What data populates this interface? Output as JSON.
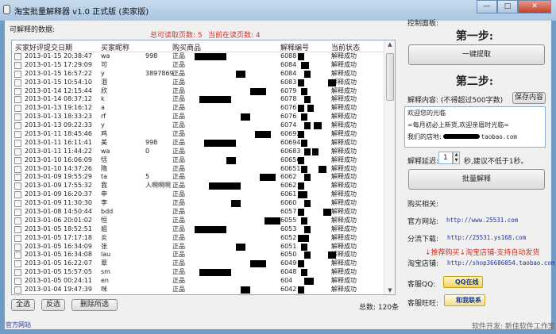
{
  "window": {
    "title": "淘宝批量解释器 v1.0 正式版 (卖家版)",
    "min": "—",
    "max": "□",
    "close": "✕"
  },
  "left": {
    "section_label": "可解释的数据:",
    "pages_total": "总可读取页数: 5",
    "pages_current": "当前在读页数: 4",
    "columns": [
      "买家好评提交日期",
      "买家昵称",
      "购买商品",
      "解释编号",
      "当前状态"
    ],
    "rows": [
      {
        "date": "2013-01-15 20:38:47",
        "nick": "wa",
        "nick2": "998",
        "item": "正品",
        "code": "6088",
        "status": "解释成功"
      },
      {
        "date": "2013-01-15 17:29:09",
        "nick": "可",
        "nick2": "",
        "item": "正品",
        "code": "6084",
        "status": "解释成功"
      },
      {
        "date": "2013-01-15 16:57:22",
        "nick": "y",
        "nick2": "3897869",
        "item": "正品",
        "code": "6084",
        "status": "解释成功"
      },
      {
        "date": "2013-01-15 10:54:10",
        "nick": "泪",
        "nick2": "",
        "item": "正品",
        "code": "6083",
        "status": "解释成功"
      },
      {
        "date": "2013-01-14 12:15:44",
        "nick": "欣",
        "nick2": "",
        "item": "正品",
        "code": "6079",
        "status": "解释成功"
      },
      {
        "date": "2013-01-14 08:37:12",
        "nick": "k",
        "nick2": "",
        "item": "正品",
        "code": "6078",
        "status": "解释成功"
      },
      {
        "date": "2013-01-13 19:16:12",
        "nick": "a",
        "nick2": "",
        "item": "正品",
        "code": "6076",
        "status": "解释成功"
      },
      {
        "date": "2013-01-13 18:33:23",
        "nick": "rf",
        "nick2": "",
        "item": "正品",
        "code": "6076",
        "status": "解释成功"
      },
      {
        "date": "2013-01-13 09:22:33",
        "nick": "y",
        "nick2": "",
        "item": "正品",
        "code": "6074",
        "status": "解释成功"
      },
      {
        "date": "2013-01-11 18:45:46",
        "nick": "鸡",
        "nick2": "",
        "item": "正品",
        "code": "60692",
        "status": "解释成功"
      },
      {
        "date": "2013-01-11 16:11:41",
        "nick": "美",
        "nick2": "998",
        "item": "正品",
        "code": "60694",
        "status": "解释成功"
      },
      {
        "date": "2013-01-11 11:44:22",
        "nick": "wa",
        "nick2": "0",
        "item": "正品",
        "code": "60683",
        "status": "解释成功"
      },
      {
        "date": "2013-01-10 16:06:09",
        "nick": "恬",
        "nick2": "",
        "item": "正品",
        "code": "60656",
        "status": "解释成功"
      },
      {
        "date": "2013-01-10 14:37:26",
        "nick": "隋",
        "nick2": "",
        "item": "正品",
        "code": "60651",
        "status": "解释成功"
      },
      {
        "date": "2013-01-09 19:55:29",
        "nick": "ta",
        "nick2": "5",
        "item": "正品",
        "code": "6062",
        "status": "解释成功"
      },
      {
        "date": "2013-01-09 17:55:32",
        "nick": "我",
        "nick2": "人啊啊啊",
        "item": "正品",
        "code": "6062",
        "status": "解释成功"
      },
      {
        "date": "2013-01-09 16:20:37",
        "nick": "申",
        "nick2": "",
        "item": "正品",
        "code": "6061",
        "status": "解释成功"
      },
      {
        "date": "2013-01-09 11:30:30",
        "nick": "李",
        "nick2": "",
        "item": "正品",
        "code": "6060",
        "status": "解释成功"
      },
      {
        "date": "2013-01-08 14:50:44",
        "nick": "bdd",
        "nick2": "",
        "item": "正品",
        "code": "6057",
        "status": "解释成功"
      },
      {
        "date": "2013-01-06 20:01:02",
        "nick": "恒",
        "nick2": "",
        "item": "正品",
        "code": "6055",
        "status": "解释成功"
      },
      {
        "date": "2013-01-05 18:52:51",
        "nick": "姐",
        "nick2": "",
        "item": "正品",
        "code": "6053",
        "status": "解释成功"
      },
      {
        "date": "2013-01-05 17:17:18",
        "nick": "炎",
        "nick2": "",
        "item": "正品",
        "code": "6052",
        "status": "解释成功"
      },
      {
        "date": "2013-01-05 16:34:09",
        "nick": "张",
        "nick2": "",
        "item": "正品",
        "code": "6051",
        "status": "解释成功"
      },
      {
        "date": "2013-01-05 16:34:08",
        "nick": "lau",
        "nick2": "",
        "item": "正品",
        "code": "6050",
        "status": "解释成功"
      },
      {
        "date": "2013-01-05 16:22:07",
        "nick": "翠",
        "nick2": "",
        "item": "正品",
        "code": "6049",
        "status": "解释成功"
      },
      {
        "date": "2013-01-05 15:57:05",
        "nick": "sm",
        "nick2": "",
        "item": "正品",
        "code": "6048",
        "status": "解释成功"
      },
      {
        "date": "2013-01-05 00:24:11",
        "nick": "en",
        "nick2": "",
        "item": "正品",
        "code": "604",
        "status": "解释成功"
      },
      {
        "date": "2013-01-04 19:47:39",
        "nick": "咪",
        "nick2": "",
        "item": "正品",
        "code": "6042",
        "status": "解释成功"
      }
    ],
    "select_all": "全选",
    "invert": "反选",
    "delete_selected": "删除所选",
    "total": "总数: 120条",
    "official_link": "官方网站"
  },
  "right": {
    "panel_label": "控制面板:",
    "step1": "第一步:",
    "fetch_button": "一键提取",
    "step2": "第二步:",
    "content_label": "解释内容: (不得超过500字数)",
    "save_button": "保存内容",
    "content_lines": [
      "欢迎您的光临",
      "=每月初必上新货,欢迎亲眉时光临=",
      "我们的店地:",
      "taobao.com"
    ],
    "delay_label": "解释延迟:",
    "delay_value": "1",
    "delay_hint": "秒,建议不低于1秒。",
    "batch_button": "批量解释",
    "purchase_label": "购买相关:",
    "site_label": "官方网站:",
    "site_url": "http://www.25531.com",
    "mirror_label": "分流下载:",
    "mirror_url": "http://25531.ys168.com",
    "promo": "↓推荐购买↓淘宝店铺-支持自动发货",
    "shop_label": "淘宝店铺:",
    "shop_url": "http://shop36686054.taobao.com",
    "qq_label": "客服QQ:",
    "qq_badge": "QQ在线",
    "ww_label": "客服旺旺:",
    "ww_badge": "和我联系",
    "developer": "软件开发: 新佳软件工作室"
  },
  "colors": {
    "accent_red": "#d0332a",
    "link": "#223399"
  }
}
